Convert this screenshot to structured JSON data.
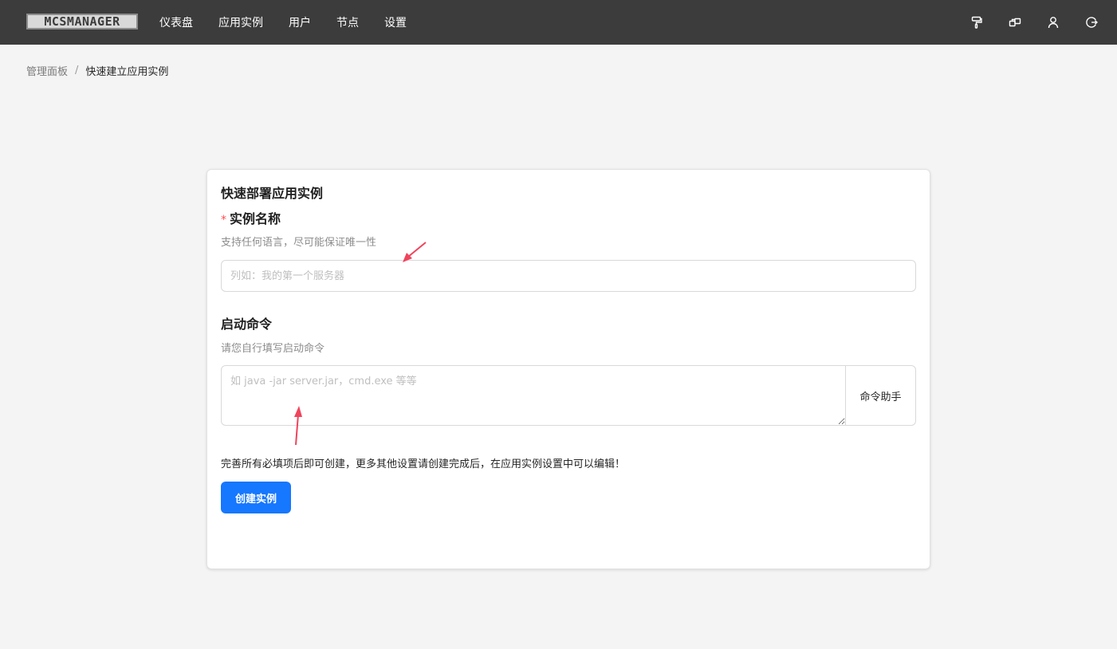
{
  "header": {
    "logo_text": "MCSMANAGER",
    "nav": [
      {
        "label": "仪表盘"
      },
      {
        "label": "应用实例"
      },
      {
        "label": "用户"
      },
      {
        "label": "节点"
      },
      {
        "label": "设置"
      }
    ],
    "icons": [
      "paint-roller-icon",
      "layout-icon",
      "user-icon",
      "logout-icon"
    ]
  },
  "breadcrumb": {
    "parent": "管理面板",
    "separator": "/",
    "current": "快速建立应用实例"
  },
  "form": {
    "title": "快速部署应用实例",
    "name_field": {
      "required_mark": "*",
      "label": "实例名称",
      "description": "支持任何语言，尽可能保证唯一性",
      "value": "",
      "placeholder": "列如：我的第一个服务器"
    },
    "command_field": {
      "label": "启动命令",
      "description": "请您自行填写启动命令",
      "value": "",
      "placeholder": "如 java -jar server.jar，cmd.exe 等等",
      "helper_button": "命令助手"
    },
    "notice": "完善所有必填项后即可创建，更多其他设置请创建完成后，在应用实例设置中可以编辑！",
    "submit_label": "创建实例"
  },
  "colors": {
    "header_bg": "#3c3c3c",
    "primary": "#1677ff",
    "required": "#ff4d4f",
    "annotation_arrow": "#f0445c"
  }
}
